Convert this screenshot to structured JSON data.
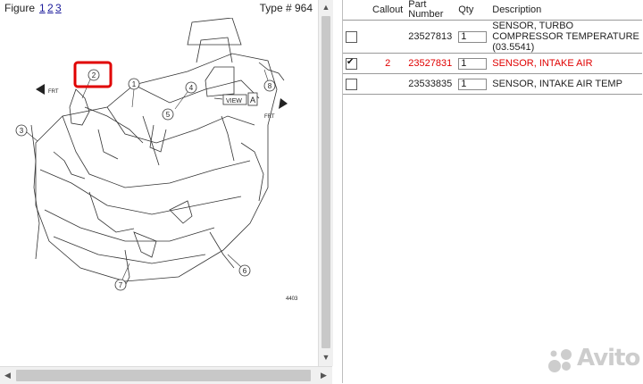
{
  "figure": {
    "label": "Figure",
    "pages": [
      "1",
      "2",
      "3"
    ],
    "type_label": "Type # 964",
    "callouts": [
      "1",
      "2",
      "3",
      "4",
      "5",
      "6",
      "7",
      "8"
    ],
    "view_tag": "VIEW",
    "view_letter": "A",
    "front_label": "FRT",
    "drawing_number": "4403"
  },
  "table": {
    "columns": {
      "callout": "Callout",
      "part_number": "Part Number",
      "qty": "Qty",
      "description": "Description"
    },
    "rows": [
      {
        "checked": false,
        "callout": "",
        "part_number": "23527813",
        "qty": "1",
        "description": "SENSOR, TURBO COMPRESSOR TEMPERATURE (03.5541)"
      },
      {
        "checked": true,
        "callout": "2",
        "part_number": "23527831",
        "qty": "1",
        "description": "SENSOR, INTAKE AIR"
      },
      {
        "checked": false,
        "callout": "",
        "part_number": "23533835",
        "qty": "1",
        "description": "SENSOR, INTAKE AIR TEMP"
      }
    ]
  },
  "colors": {
    "selected_row": "#e00000",
    "highlight_box": "#e00000"
  },
  "watermark": "Avito"
}
